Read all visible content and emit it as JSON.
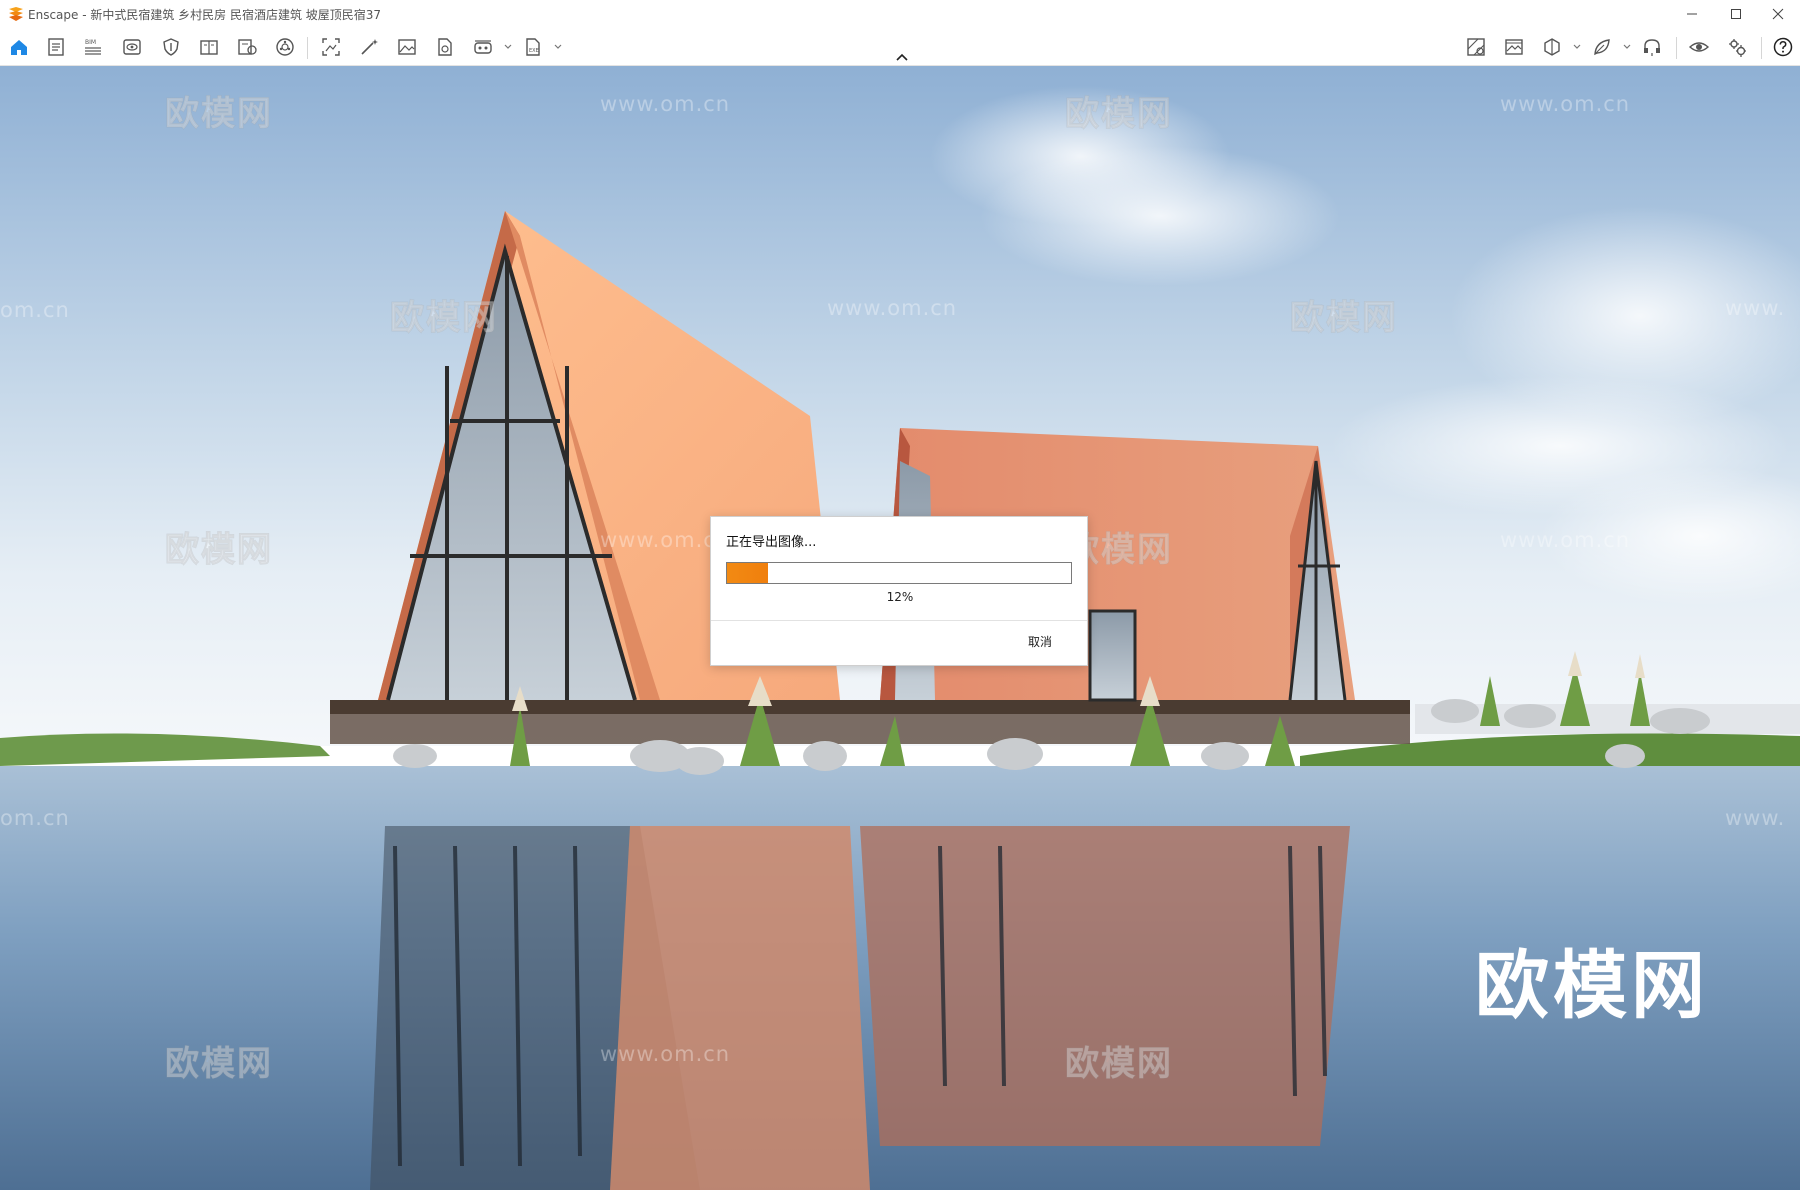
{
  "window": {
    "title": "Enscape - 新中式民宿建筑 乡村民房 民宿酒店建筑 坡屋顶民宿37",
    "controls": [
      "minimize-icon",
      "maximize-icon",
      "close-icon"
    ]
  },
  "toolbar": {
    "left_tools": [
      "home-icon",
      "document-icon",
      "bim-icon",
      "visual-settings-icon",
      "shield-icon",
      "book-icon",
      "video-editor-icon",
      "asset-library-icon",
      "capture-screenshot-icon",
      "magic-wand-icon",
      "image-icon",
      "file-export-icon",
      "vr-icon",
      "export-icon"
    ],
    "bim_label": "BIM",
    "right_tools": [
      "material-icon",
      "gallery-icon",
      "cube-icon",
      "leaf-icon",
      "headset-icon",
      "eye-icon",
      "settings-icon",
      "help-icon"
    ]
  },
  "viewport": {
    "watermark_cn": "欧模网",
    "watermark_url": "www.om.cn",
    "watermark_url_short": "om.cn",
    "watermark_url_right": "www.",
    "brand_watermark": "欧模网"
  },
  "dialog": {
    "message": "正在导出图像...",
    "progress_value": 12,
    "progress_label": "12%",
    "cancel_label": "取消"
  }
}
